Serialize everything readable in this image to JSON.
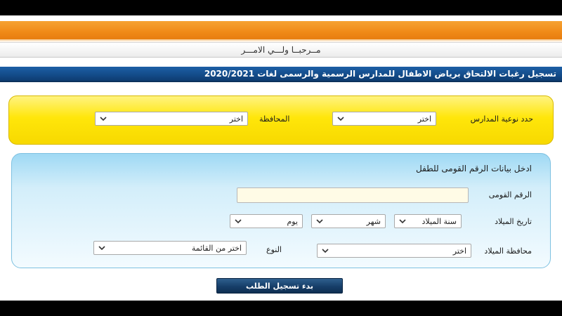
{
  "header": {
    "welcome": "مــرحبــا ولـــي الامـــر",
    "title": "تسجيل رغبات الالتحاق برياض الاطفال للمدارس الرسمية والرسمى لغات 2020/2021"
  },
  "school_filter": {
    "school_type_label": "حدد نوعية المدارس",
    "school_type_value": "اختر",
    "governorate_label": "المحافظة",
    "governorate_value": "اختر"
  },
  "child_data": {
    "section_title": "ادخل بيانات الرقم القومى للطفل",
    "national_id_label": "الرقم القومى",
    "national_id_value": "",
    "birth_date_label": "تاريخ الميلاد",
    "birth_year_value": "سنة الميلاد",
    "birth_month_value": "شهر",
    "birth_day_value": "يوم",
    "birth_governorate_label": "محافظة الميلاد",
    "birth_governorate_value": "اختر",
    "gender_label": "النوع",
    "gender_value": "اختر من القائمة"
  },
  "actions": {
    "submit_label": "بدء تسجيل الطلب"
  },
  "colors": {
    "orange": "#f08a17",
    "navy": "#134b88",
    "yellow": "#ffe60a",
    "light_blue": "#9fd9f4"
  }
}
